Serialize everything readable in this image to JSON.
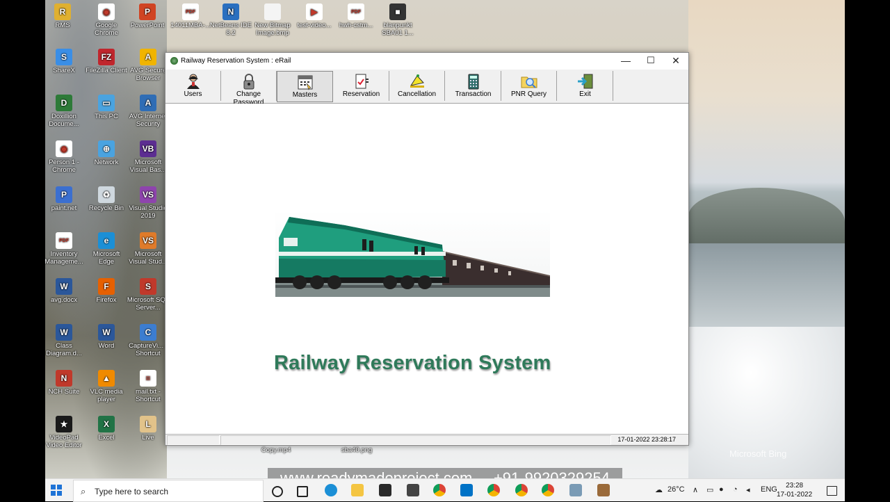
{
  "desktop": {
    "icons": [
      {
        "label": "RMS",
        "color": "#e0b030",
        "glyph": "R"
      },
      {
        "label": "Google Chrome",
        "color": "#ffffff",
        "glyph": "◉"
      },
      {
        "label": "PowerPoint",
        "color": "#d04423",
        "glyph": "P"
      },
      {
        "label": "14011MBA-...",
        "color": "#ffffff",
        "glyph": "PDF"
      },
      {
        "label": "NetBeans IDE 8.2",
        "color": "#2a6fbf",
        "glyph": "N"
      },
      {
        "label": "New Bitmap Image.bmp",
        "color": "#f4f4f4",
        "glyph": ""
      },
      {
        "label": "test-video...",
        "color": "#ffffff",
        "glyph": "▶"
      },
      {
        "label": "hwh-cstm...",
        "color": "#ffffff",
        "glyph": "PDF"
      },
      {
        "label": "blanpunkt SBA01 1...",
        "color": "#333333",
        "glyph": "■"
      },
      {
        "label": "ShareX",
        "color": "#3a8ee6",
        "glyph": "S"
      },
      {
        "label": "FileZilla Client",
        "color": "#c0262d",
        "glyph": "FZ"
      },
      {
        "label": "AVG Secure Browser",
        "color": "#f0b400",
        "glyph": "A"
      },
      {
        "label": "Doxillion Docume...",
        "color": "#2d7a38",
        "glyph": "D"
      },
      {
        "label": "This PC",
        "color": "#4aa3e0",
        "glyph": "▭"
      },
      {
        "label": "AVG Internet Security",
        "color": "#2f6db5",
        "glyph": "A"
      },
      {
        "label": "Person 1 - Chrome",
        "color": "#ffffff",
        "glyph": "◉"
      },
      {
        "label": "Network",
        "color": "#4aa3e0",
        "glyph": "⊕"
      },
      {
        "label": "Microsoft Visual Bas...",
        "color": "#5c2d91",
        "glyph": "VB"
      },
      {
        "label": "paint.net",
        "color": "#3b6fd0",
        "glyph": "P"
      },
      {
        "label": "Recycle Bin",
        "color": "#cfd8df",
        "glyph": "♻"
      },
      {
        "label": "Visual Studio 2019",
        "color": "#8e44ad",
        "glyph": "VS"
      },
      {
        "label": "Inventory Manageme...",
        "color": "#ffffff",
        "glyph": "PDF"
      },
      {
        "label": "Microsoft Edge",
        "color": "#1b8fd6",
        "glyph": "e"
      },
      {
        "label": "Microsoft Visual Stud...",
        "color": "#e07b2a",
        "glyph": "VS"
      },
      {
        "label": "avg.docx",
        "color": "#2b579a",
        "glyph": "W"
      },
      {
        "label": "Firefox",
        "color": "#e66000",
        "glyph": "F"
      },
      {
        "label": "Microsoft SQL Server...",
        "color": "#c0392b",
        "glyph": "S"
      },
      {
        "label": "Class Diagram.d...",
        "color": "#2b579a",
        "glyph": "W"
      },
      {
        "label": "Word",
        "color": "#2b579a",
        "glyph": "W"
      },
      {
        "label": "CaptureVi... - Shortcut",
        "color": "#3c7dd0",
        "glyph": "C"
      },
      {
        "label": "NCH Suite",
        "color": "#c0392b",
        "glyph": "N"
      },
      {
        "label": "VLC media player",
        "color": "#f08a00",
        "glyph": "▲"
      },
      {
        "label": "mail.txt - Shortcut",
        "color": "#ffffff",
        "glyph": "≡"
      },
      {
        "label": "VideoPad Video Editor",
        "color": "#1a1a1a",
        "glyph": "★"
      },
      {
        "label": "Excel",
        "color": "#217346",
        "glyph": "X"
      },
      {
        "label": "Live",
        "color": "#e2c38a",
        "glyph": "L"
      }
    ],
    "files_behind": [
      {
        "label": "Copy.mp4"
      },
      {
        "label": "sba40.png"
      }
    ],
    "brand_watermark": "Microsoft Bing"
  },
  "window": {
    "title": "Railway Reservation System : eRail",
    "controls": {
      "minimize": "—",
      "maximize": "☐",
      "close": "✕"
    }
  },
  "toolbar": {
    "items": [
      {
        "label": "Users"
      },
      {
        "label": "Change Password"
      },
      {
        "label": "Masters"
      },
      {
        "label": "Reservation"
      },
      {
        "label": "Cancellation"
      },
      {
        "label": "Transaction"
      },
      {
        "label": "PNR Query"
      },
      {
        "label": "Exit"
      }
    ],
    "active_index": 2
  },
  "content": {
    "heading": "Railway Reservation System"
  },
  "statusbar": {
    "datetime": "17-01-2022 23:28:17"
  },
  "overlay_banner": {
    "website": "www.readymadeproject.com",
    "phone": "+91-9920329254"
  },
  "taskbar": {
    "search_placeholder": "Type here to search",
    "weather": "26°C",
    "language": "ENG",
    "time": "23:28",
    "date": "17-01-2022"
  }
}
